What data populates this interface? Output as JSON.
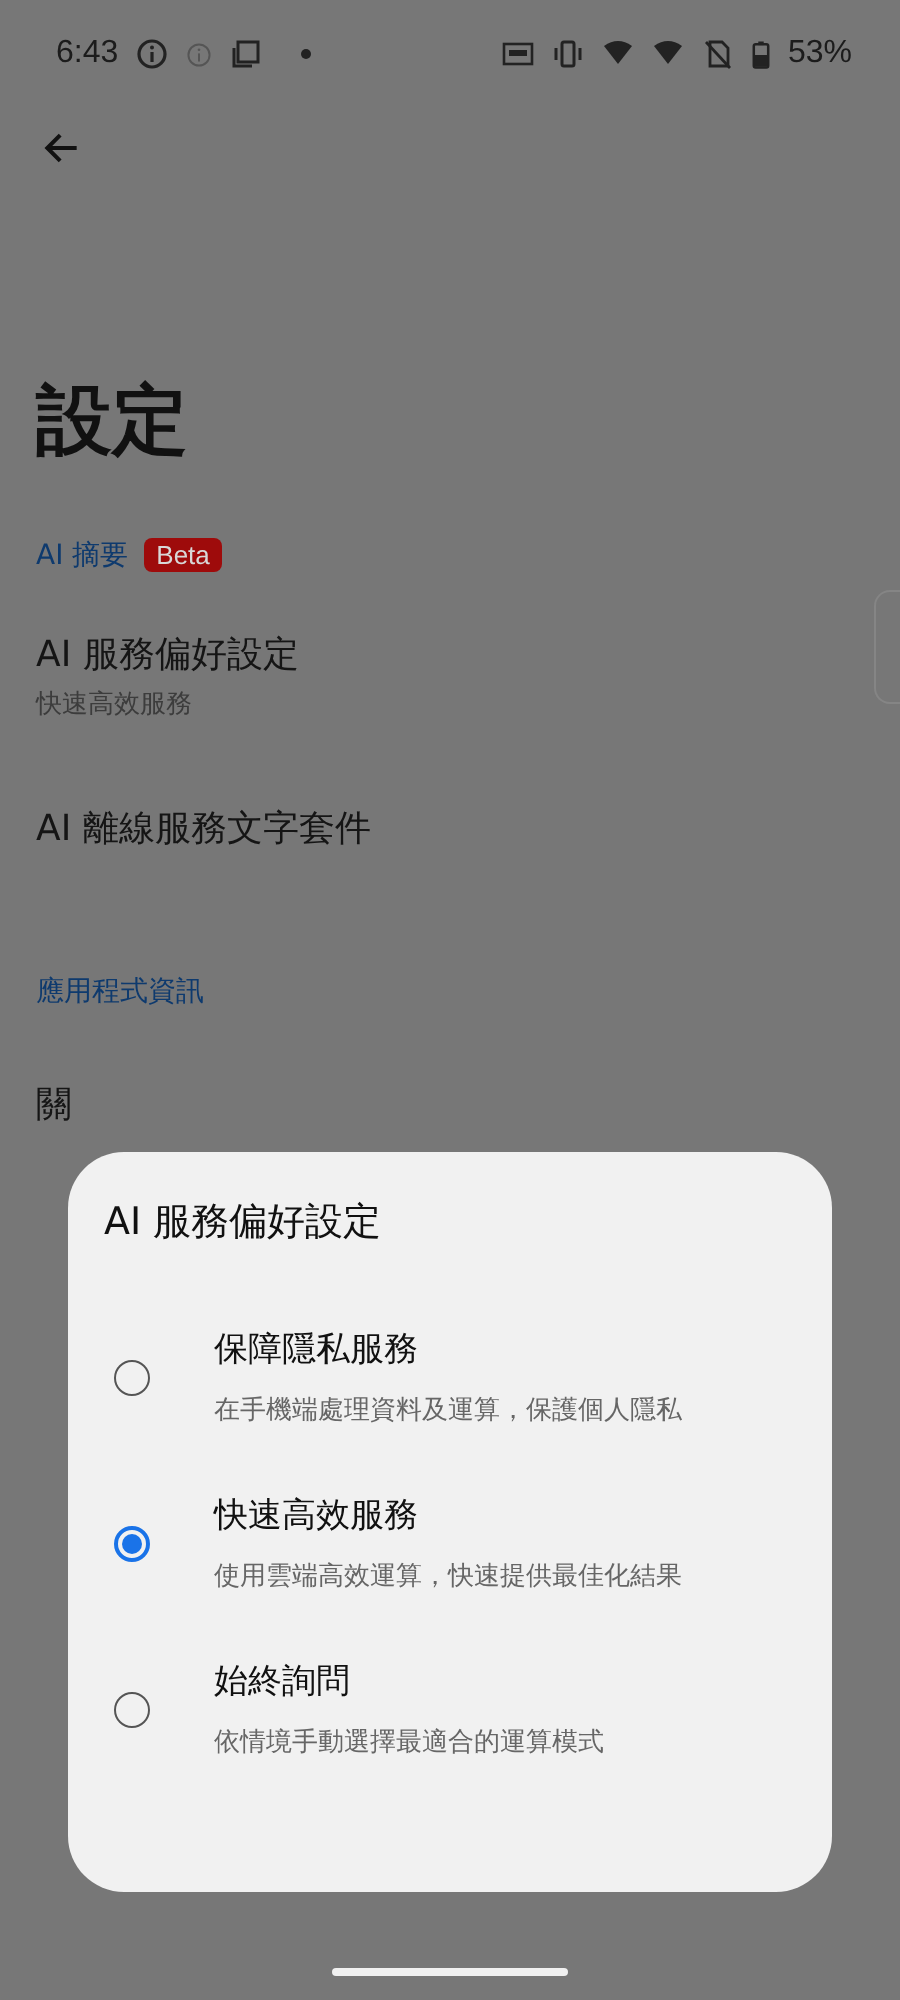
{
  "status_bar": {
    "time": "6:43",
    "battery": "53%"
  },
  "page": {
    "title": "設定"
  },
  "sections": [
    {
      "header": "AI 摘要",
      "badge": "Beta",
      "items": [
        {
          "title": "AI 服務偏好設定",
          "subtitle": "快速高效服務"
        },
        {
          "title": "AI 離線服務文字套件"
        }
      ]
    },
    {
      "header": "應用程式資訊",
      "items": [
        {
          "title": "關"
        }
      ]
    }
  ],
  "dialog": {
    "title": "AI 服務偏好設定",
    "options": [
      {
        "label": "保障隱私服務",
        "description": "在手機端處理資料及運算，保護個人隱私",
        "selected": false
      },
      {
        "label": "快速高效服務",
        "description": "使用雲端高效運算，快速提供最佳化結果",
        "selected": true
      },
      {
        "label": "始終詢問",
        "description": "依情境手動選擇最適合的運算模式",
        "selected": false
      }
    ]
  }
}
